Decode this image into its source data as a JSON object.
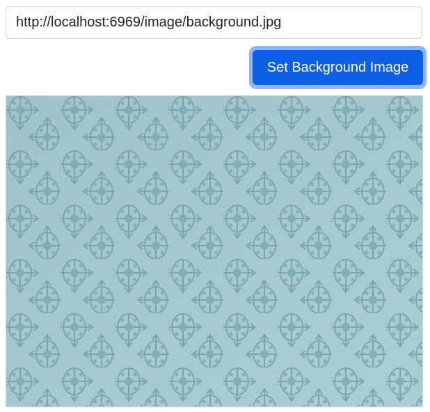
{
  "form": {
    "url_value": "http://localhost:6969/image/background.jpg",
    "submit_label": "Set Background Image"
  },
  "preview": {
    "icon": "damask-pattern-image"
  },
  "colors": {
    "button_bg": "#0d5fe3",
    "button_focus_ring": "#8fb4f7",
    "input_border": "#ced4da",
    "pattern_bg": "#a3c9cf",
    "pattern_motif": "#6fa0a8"
  }
}
